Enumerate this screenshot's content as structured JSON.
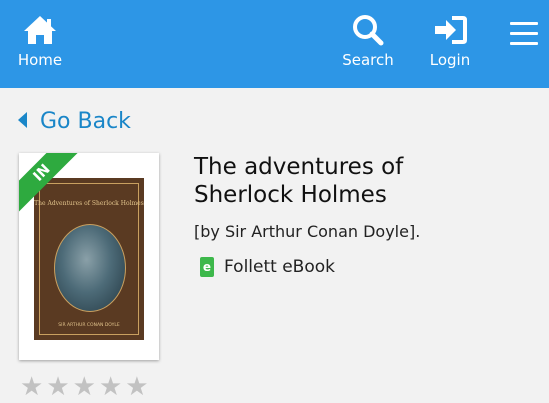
{
  "header": {
    "home_label": "Home",
    "search_label": "Search",
    "login_label": "Login",
    "home_icon": "house-icon",
    "search_icon": "magnifier-icon",
    "login_icon": "sign-in-icon",
    "menu_icon": "hamburger-icon",
    "brand_color": "#2d96e6"
  },
  "nav": {
    "go_back_label": "Go Back"
  },
  "book": {
    "title": "The adventures of Sherlock Holmes",
    "author": "[by Sir Arthur Conan Doyle].",
    "format": "Follett eBook",
    "availability_badge": "IN",
    "cover_title": "The Adventures of Sherlock Holmes",
    "cover_author": "SIR ARTHUR CONAN DOYLE",
    "rating": 0,
    "rating_max": 5
  }
}
